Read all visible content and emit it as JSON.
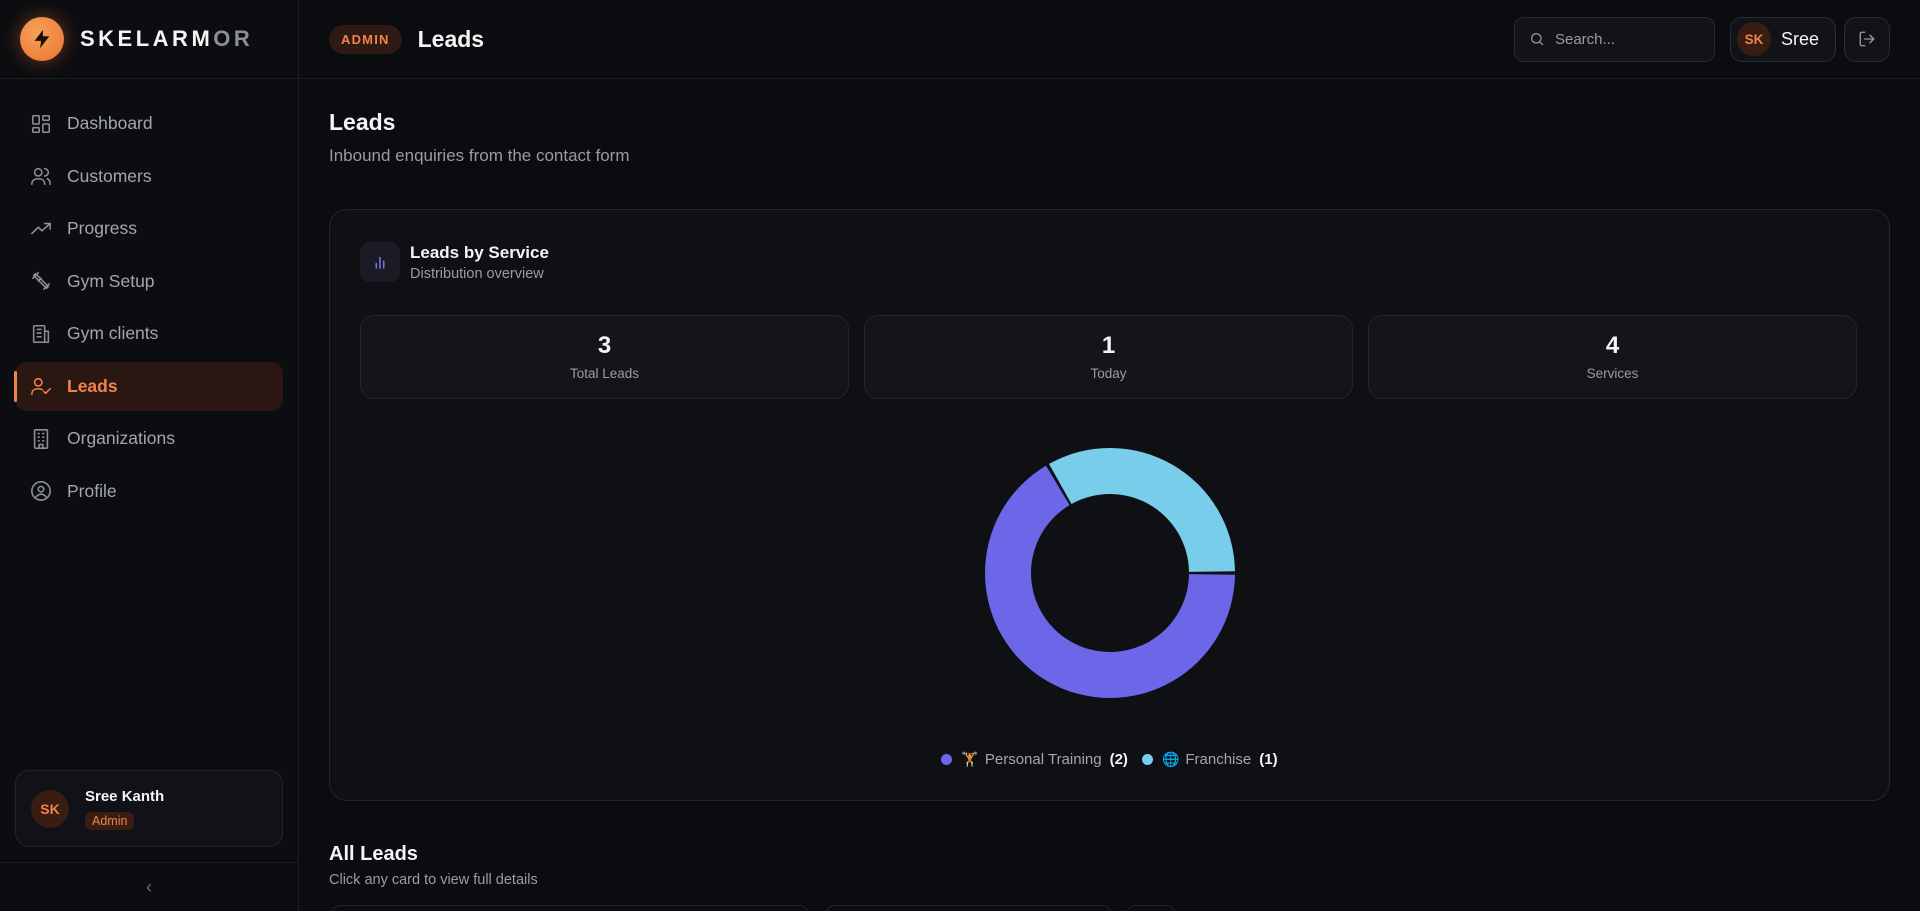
{
  "brand": {
    "name_main": "SKELARM",
    "name_dim": "OR"
  },
  "sidebar": {
    "items": [
      {
        "label": "Dashboard",
        "icon": "grid-icon"
      },
      {
        "label": "Customers",
        "icon": "users-icon"
      },
      {
        "label": "Progress",
        "icon": "trending-up-icon"
      },
      {
        "label": "Gym Setup",
        "icon": "dumbbell-icon"
      },
      {
        "label": "Gym clients",
        "icon": "building-icon"
      },
      {
        "label": "Leads",
        "icon": "user-check-icon",
        "active": true
      },
      {
        "label": "Organizations",
        "icon": "office-icon"
      },
      {
        "label": "Profile",
        "icon": "profile-icon"
      }
    ],
    "user": {
      "initials": "SK",
      "name": "Sree Kanth",
      "role": "Admin"
    },
    "collapse_glyph": "‹"
  },
  "topbar": {
    "badge": "ADMIN",
    "title": "Leads",
    "search_placeholder": "Search...",
    "user_initials": "SK",
    "user_name": "Sree"
  },
  "page": {
    "title": "Leads",
    "subtitle": "Inbound enquiries from the contact form"
  },
  "card": {
    "title": "Leads by Service",
    "subtitle": "Distribution overview",
    "stats": [
      {
        "value": "3",
        "label": "Total Leads"
      },
      {
        "value": "1",
        "label": "Today"
      },
      {
        "value": "4",
        "label": "Services"
      }
    ]
  },
  "chart_data": {
    "type": "pie",
    "style": "donut",
    "categories": [
      "🏋️ Personal Training",
      "🌐 Franchise"
    ],
    "values": [
      2,
      1
    ],
    "colors": [
      "#6c67e8",
      "#78cdea"
    ],
    "legend": "bottom"
  },
  "legend": {
    "items": [
      {
        "emoji": "🏋️",
        "label": "Personal Training",
        "count": "(2)",
        "color": "#6c67e8"
      },
      {
        "emoji": "🌐",
        "label": "Franchise",
        "count": "(1)",
        "color": "#78cdea"
      }
    ]
  },
  "all_leads": {
    "title": "All Leads",
    "subtitle": "Click any card to view full details"
  }
}
